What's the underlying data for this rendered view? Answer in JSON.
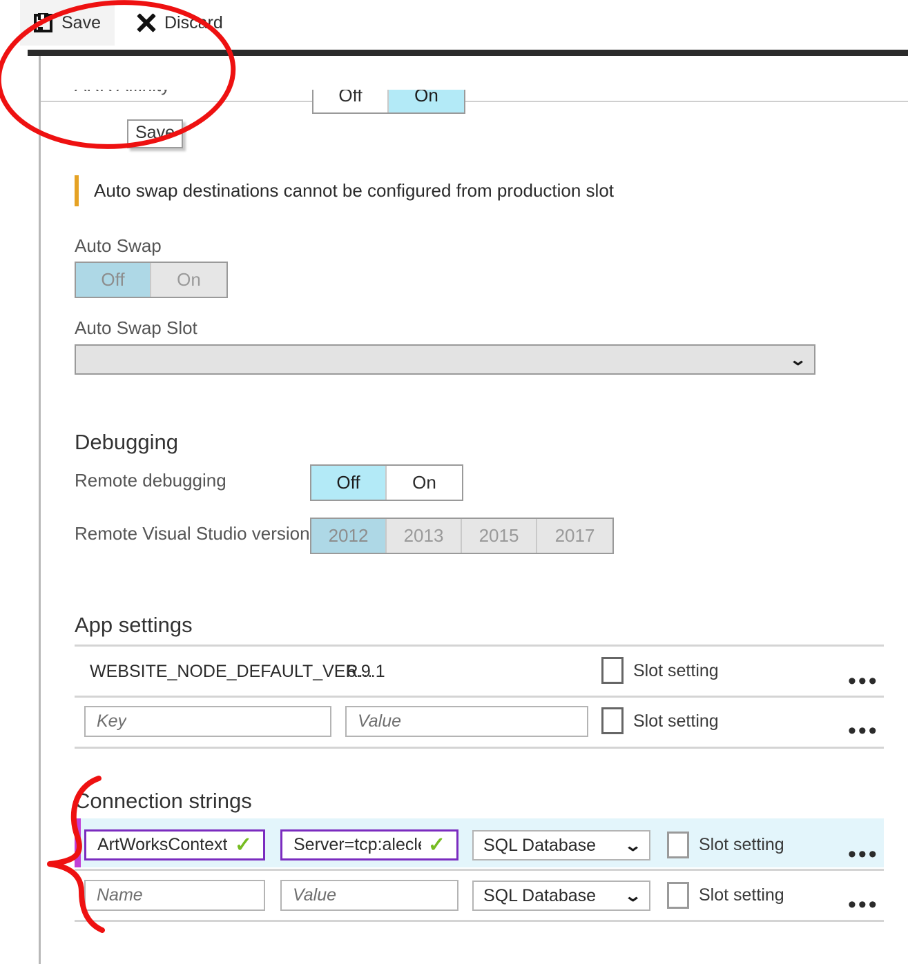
{
  "toolbar": {
    "save_label": "Save",
    "discard_label": "Discard",
    "save_tooltip": "Save"
  },
  "arr_affinity": {
    "label": "ARR Affinity",
    "options": [
      "Off",
      "On"
    ],
    "selected": "On"
  },
  "banner": {
    "message": "Auto swap destinations cannot be configured from production slot"
  },
  "auto_swap": {
    "label": "Auto Swap",
    "options": [
      "Off",
      "On"
    ],
    "selected": "Off",
    "enabled": false
  },
  "auto_swap_slot": {
    "label": "Auto Swap Slot",
    "value": "",
    "chevron": "⌄",
    "enabled": false
  },
  "debugging": {
    "heading": "Debugging",
    "remote_debugging": {
      "label": "Remote debugging",
      "options": [
        "Off",
        "On"
      ],
      "selected": "Off"
    },
    "vs_version": {
      "label": "Remote Visual Studio version",
      "options": [
        "2012",
        "2013",
        "2015",
        "2017"
      ],
      "selected": "2012",
      "enabled": false
    }
  },
  "app_settings": {
    "heading": "App settings",
    "slot_setting_label": "Slot setting",
    "ellipsis": "•••",
    "rows": [
      {
        "key": "WEBSITE_NODE_DEFAULT_VER...",
        "value": "6.9.1",
        "slot_setting": false
      }
    ],
    "new_row": {
      "key_placeholder": "Key",
      "value_placeholder": "Value",
      "slot_setting": false
    }
  },
  "connection_strings": {
    "heading": "Connection strings",
    "slot_setting_label": "Slot setting",
    "ellipsis": "•••",
    "check_glyph": "✓",
    "chevron": "⌄",
    "rows": [
      {
        "name": "ArtWorksContext",
        "value": "Server=tcp:aleclerc",
        "type": "SQL Database",
        "slot_setting": false,
        "highlighted": true
      }
    ],
    "new_row": {
      "name_placeholder": "Name",
      "value_placeholder": "Value",
      "type": "SQL Database",
      "slot_setting": false
    }
  },
  "colors": {
    "accent_cyan": "#b3eaf7",
    "accent_cyan_disabled": "#aed8e6",
    "banner_orange": "#e5a224",
    "valid_purple": "#7b2cbf",
    "row_marker_purple": "#c13fd6",
    "row_highlight": "#e3f5fb",
    "annotation_red": "#ee1111",
    "check_green": "#76bc21",
    "topbar_dark": "#2b2b2b"
  }
}
